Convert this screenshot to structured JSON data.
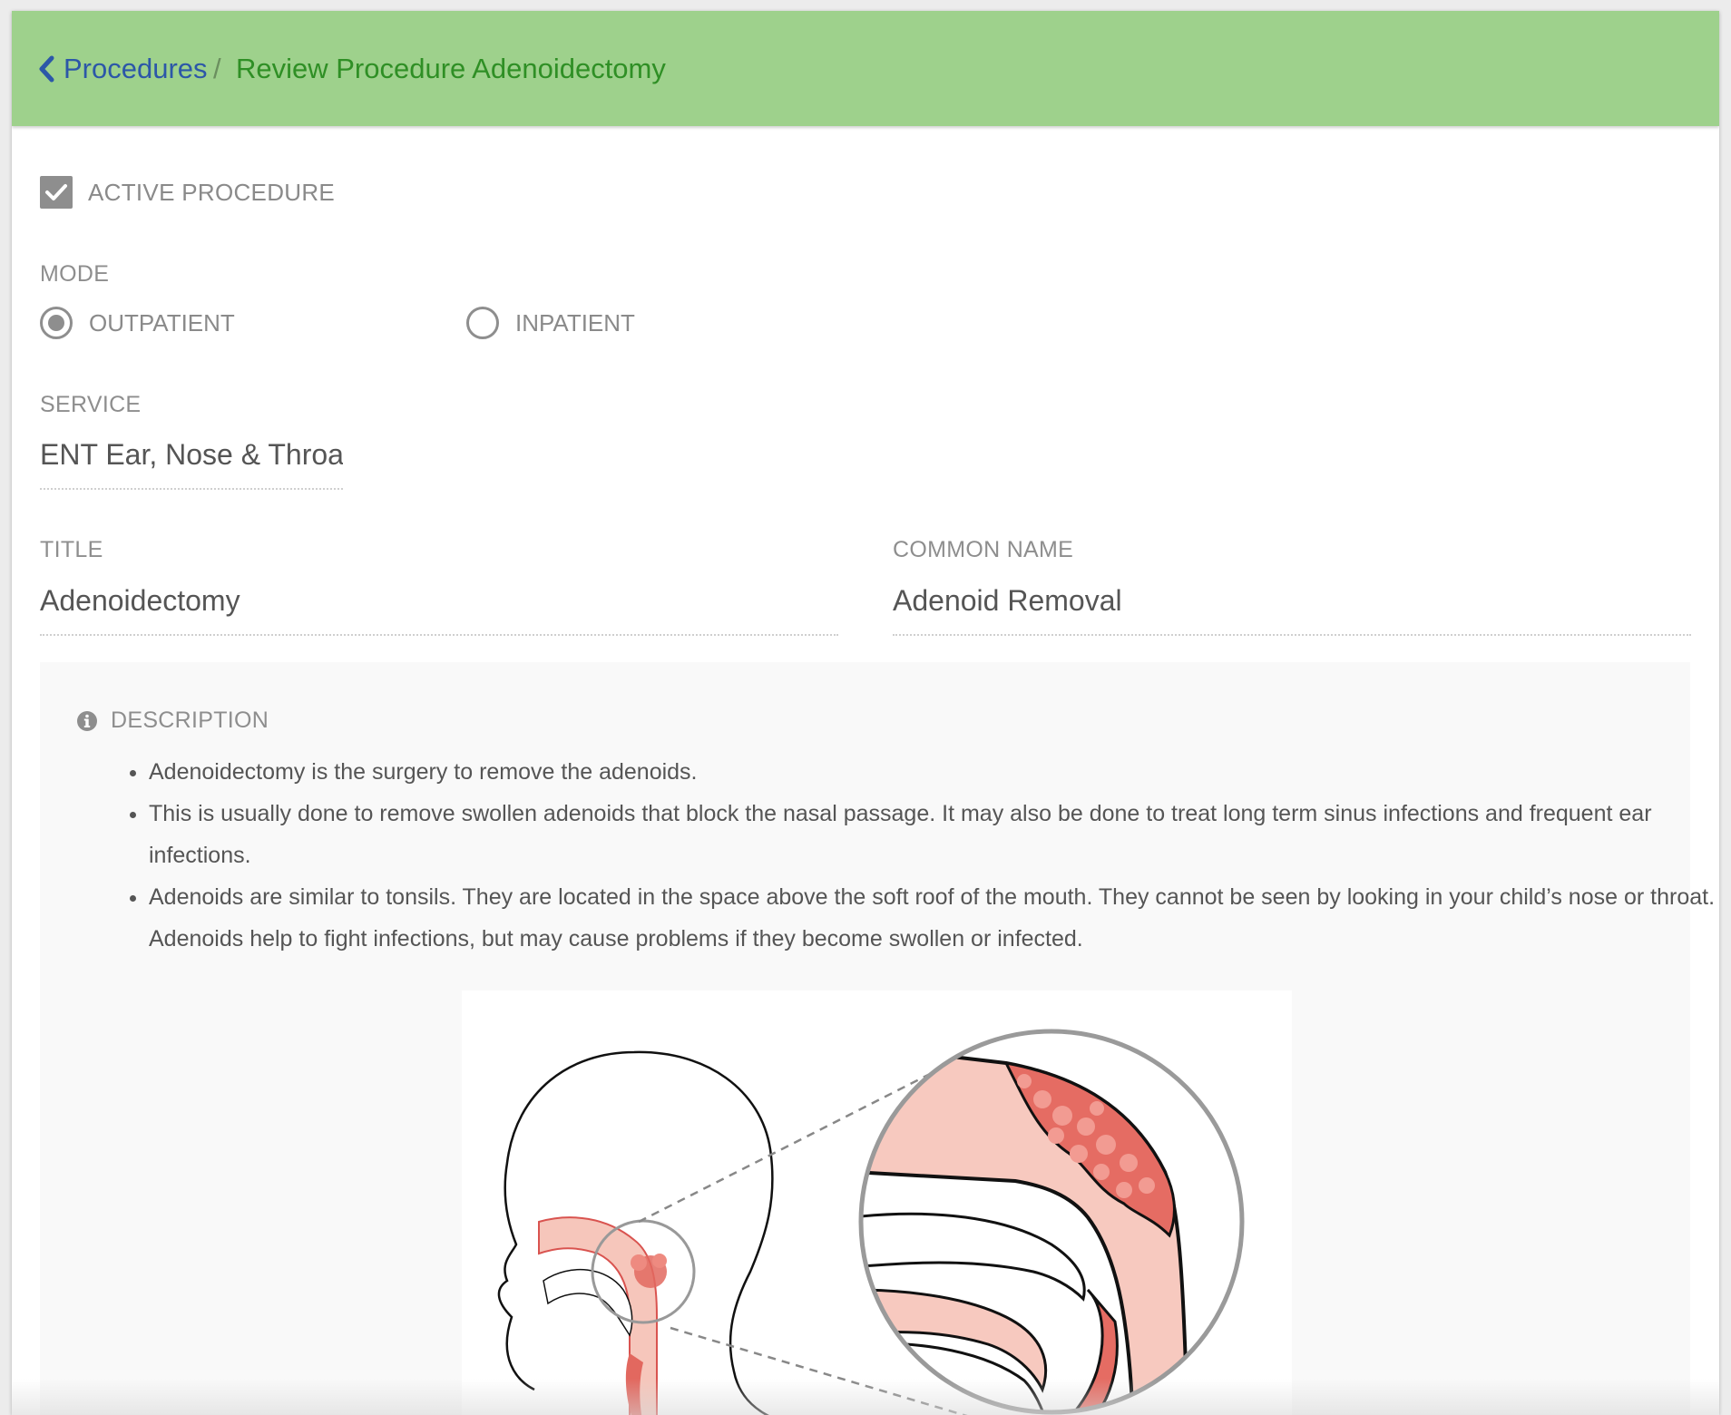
{
  "header": {
    "back_label": "Procedures",
    "separator": "/",
    "current_label": "Review Procedure Adenoidectomy",
    "background_color": "#9ed18c"
  },
  "active_procedure": {
    "label": "ACTIVE PROCEDURE",
    "checked": true
  },
  "mode": {
    "label": "MODE",
    "options": [
      {
        "label": "OUTPATIENT",
        "selected": true
      },
      {
        "label": "INPATIENT",
        "selected": false
      }
    ]
  },
  "service": {
    "label": "SERVICE",
    "value": "ENT  Ear, Nose & Throat"
  },
  "title_field": {
    "label": "TITLE",
    "value": "Adenoidectomy"
  },
  "common_name": {
    "label": "COMMON NAME",
    "value": "Adenoid Removal"
  },
  "description": {
    "label": "DESCRIPTION",
    "items": [
      "Adenoidectomy is the surgery to remove the adenoids.",
      "This is usually done to remove swollen adenoids that block the nasal passage. It may also be done to treat long term sinus infections and frequent ear infections.",
      "Adenoids are similar to tonsils. They are located in the space above the soft roof of the mouth. They cannot be seen by looking in your child’s nose or throat. Adenoids help to fight infections, but may cause problems if they become swollen or infected."
    ]
  }
}
